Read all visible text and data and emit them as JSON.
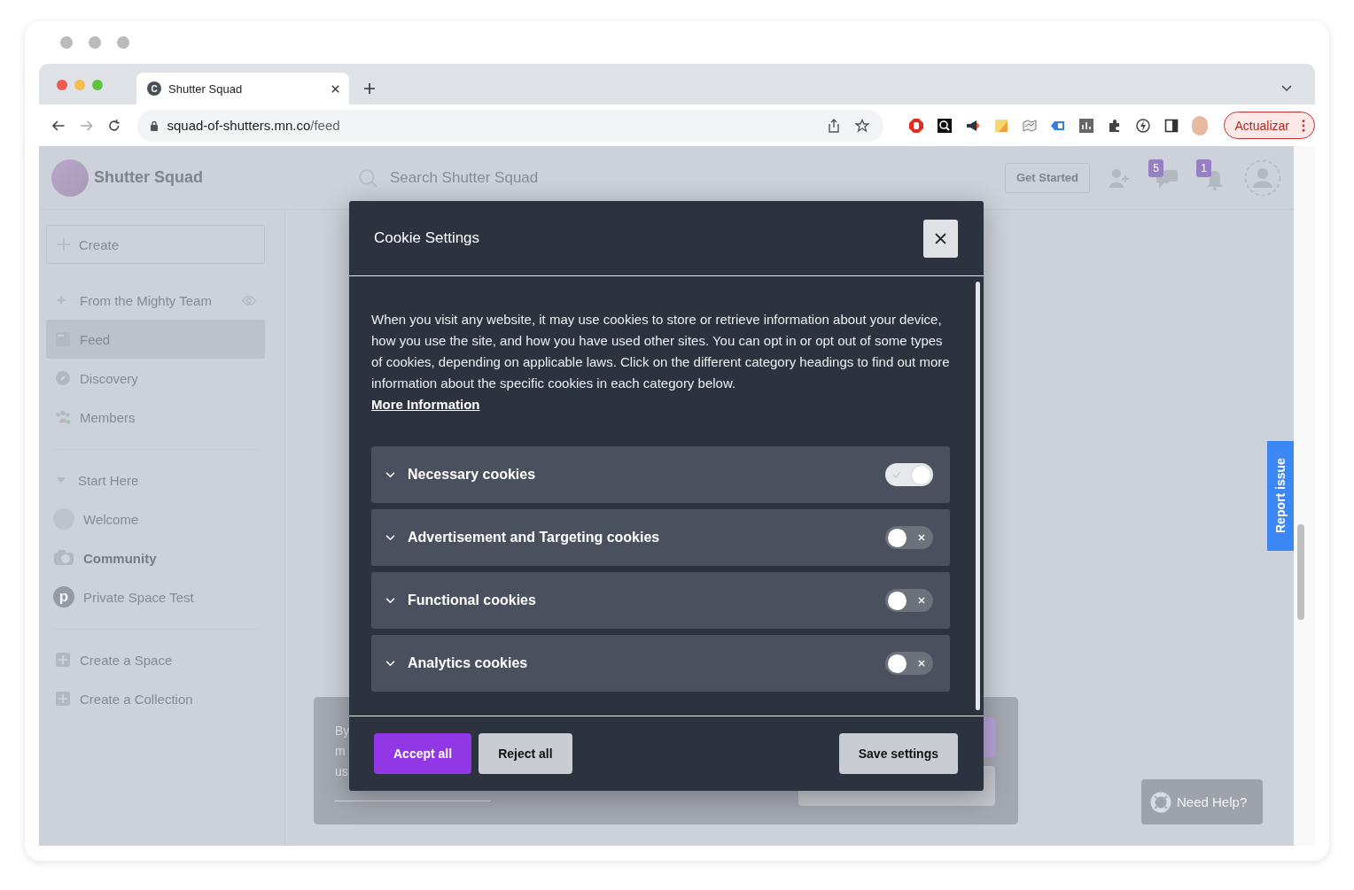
{
  "browser": {
    "tab_title": "Shutter Squad",
    "tab_favicon": "C",
    "url_host": "squad-of-shutters.mn.co",
    "url_path": "/feed",
    "update_button": "Actualizar"
  },
  "site": {
    "name": "Shutter Squad",
    "search_placeholder": "Search Shutter Squad",
    "get_started": "Get Started",
    "chat_badge": "5",
    "notif_badge": "1"
  },
  "sidebar": {
    "create": "Create",
    "items": [
      {
        "label": "From the Mighty Team",
        "kind": "sparkle",
        "selected": false
      },
      {
        "label": "Feed",
        "kind": "feed",
        "selected": true
      },
      {
        "label": "Discovery",
        "kind": "compass",
        "selected": false
      },
      {
        "label": "Members",
        "kind": "people",
        "selected": false
      }
    ],
    "section": {
      "label": "Start Here",
      "expanded": true,
      "items": [
        {
          "label": "Welcome",
          "kind": "blank",
          "unread": false
        },
        {
          "label": "Community",
          "kind": "camera",
          "unread": true
        },
        {
          "label": "Private Space Test",
          "kind": "letter",
          "letter": "p",
          "unread": false
        }
      ]
    },
    "actions": [
      "Create a Space",
      "Create a Collection"
    ]
  },
  "banner": {
    "lines": [
      "By",
      "m",
      "us"
    ]
  },
  "modal": {
    "title": "Cookie Settings",
    "body": "When you visit any website, it may use cookies to store or retrieve information about your device, how you use the site, and how you have used other sites. You can opt in or opt out of some types of cookies, depending on applicable laws. Click on the different category headings to find out more information about the specific cookies in each category below.",
    "more_link": "More Information",
    "categories": [
      {
        "name": "Necessary cookies",
        "on": true
      },
      {
        "name": "Advertisement and Targeting cookies",
        "on": false
      },
      {
        "name": "Functional cookies",
        "on": false
      },
      {
        "name": "Analytics cookies",
        "on": false
      }
    ],
    "buttons": [
      {
        "label": "Accept all",
        "kind": "primary"
      },
      {
        "label": "Reject all",
        "kind": "secondary"
      },
      {
        "label": "Save settings",
        "kind": "tertiary"
      }
    ]
  },
  "report_issue": "Report issue",
  "help": "Need Help?"
}
